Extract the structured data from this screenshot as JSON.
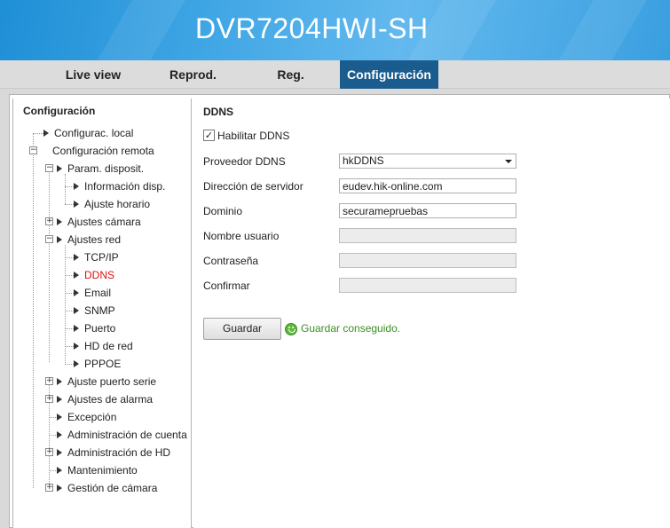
{
  "header": {
    "title": "DVR7204HWI-SH"
  },
  "nav": {
    "tabs": [
      {
        "label": "Live view",
        "active": false
      },
      {
        "label": "Reprod.",
        "active": false
      },
      {
        "label": "Reg.",
        "active": false
      },
      {
        "label": "Configuración",
        "active": true
      }
    ]
  },
  "tree": {
    "title": "Configuración",
    "items": [
      {
        "label": "Configurac. local"
      },
      {
        "label": "Configuración remota"
      },
      {
        "label": "Param. disposit."
      },
      {
        "label": "Información disp."
      },
      {
        "label": "Ajuste horario"
      },
      {
        "label": "Ajustes cámara"
      },
      {
        "label": "Ajustes red"
      },
      {
        "label": "TCP/IP"
      },
      {
        "label": "DDNS",
        "selected": true
      },
      {
        "label": "Email"
      },
      {
        "label": "SNMP"
      },
      {
        "label": "Puerto"
      },
      {
        "label": "HD de red"
      },
      {
        "label": "PPPOE"
      },
      {
        "label": "Ajuste puerto serie"
      },
      {
        "label": "Ajustes de alarma"
      },
      {
        "label": "Excepción"
      },
      {
        "label": "Administración de cuenta"
      },
      {
        "label": "Administración de HD"
      },
      {
        "label": "Mantenimiento"
      },
      {
        "label": "Gestión de cámara"
      }
    ]
  },
  "panel": {
    "title": "DDNS",
    "enable_label": "Habilitar DDNS",
    "enable_checked": true,
    "provider_label": "Proveedor DDNS",
    "provider_value": "hkDDNS",
    "server_label": "Dirección de servidor",
    "server_value": "eudev.hik-online.com",
    "domain_label": "Dominio",
    "domain_value": "securamepruebas",
    "user_label": "Nombre usuario",
    "user_value": "",
    "password_label": "Contraseña",
    "password_value": "",
    "confirm_label": "Confirmar",
    "confirm_value": "",
    "save_label": "Guardar",
    "status_message": "Guardar conseguido.",
    "status_color": "#3a8f22"
  }
}
